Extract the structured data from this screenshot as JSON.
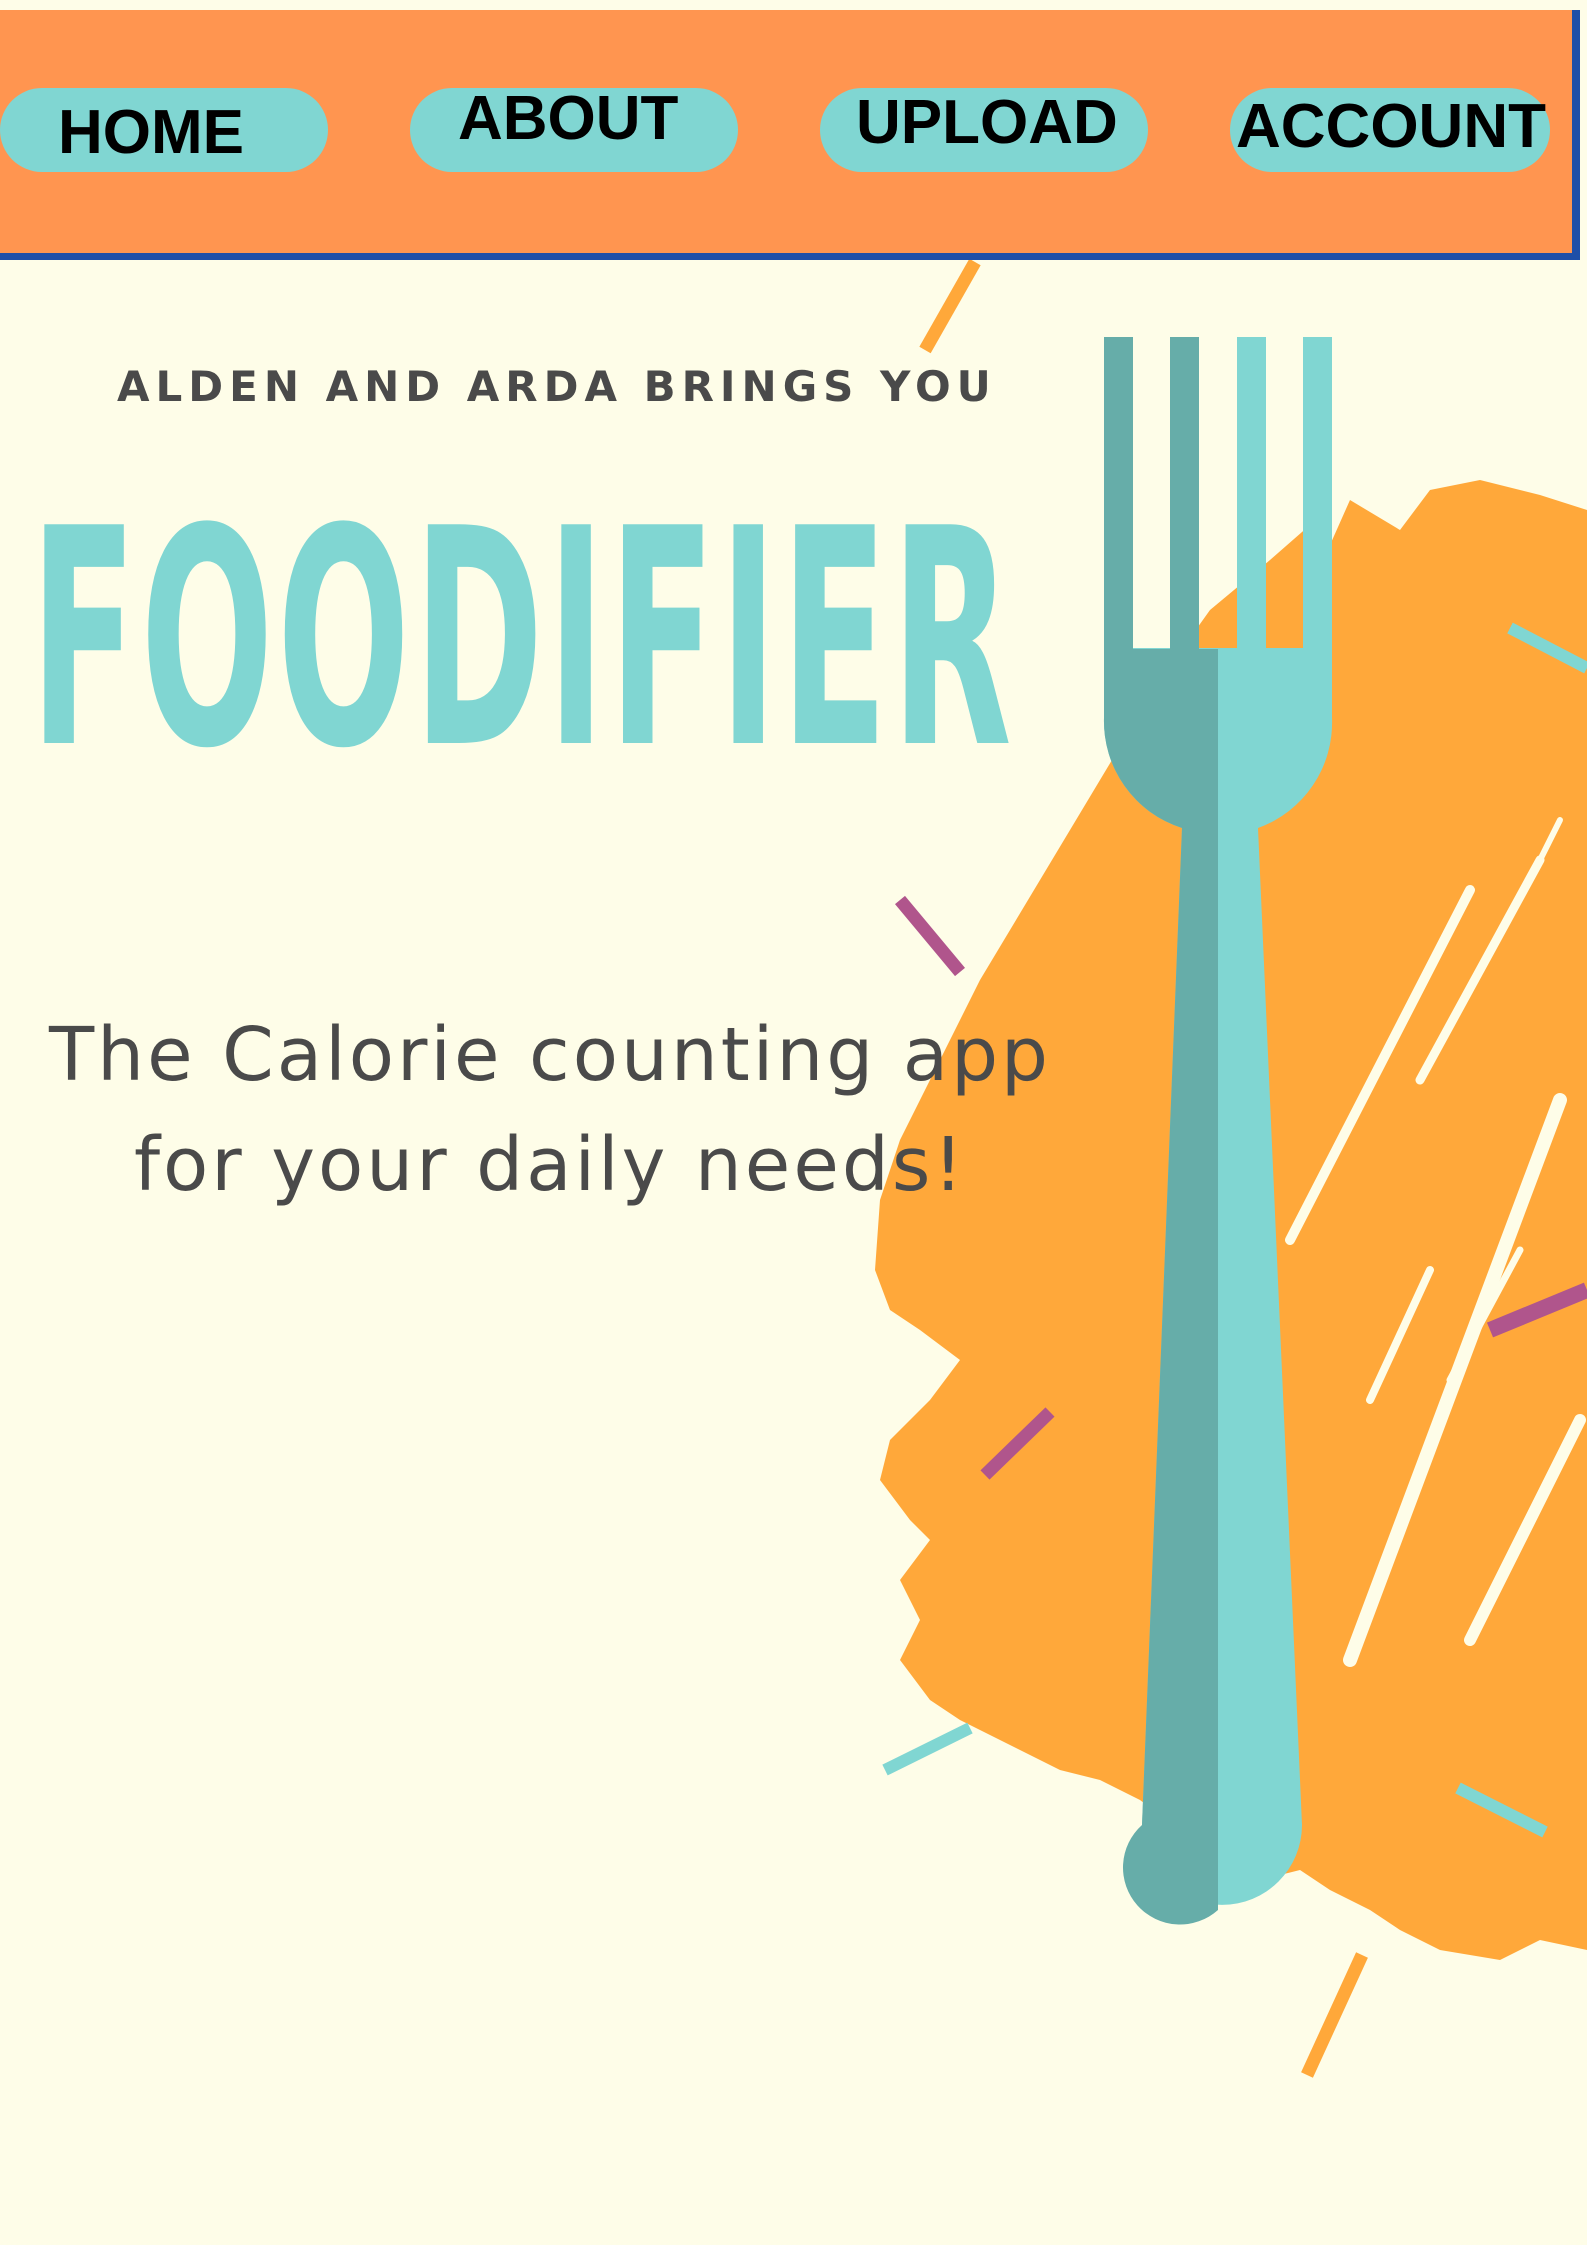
{
  "nav": {
    "items": [
      {
        "label": "HOME"
      },
      {
        "label": "ABOUT"
      },
      {
        "label": "UPLOAD"
      },
      {
        "label": "ACCOUNT"
      }
    ]
  },
  "hero": {
    "tagline": "ALDEN AND ARDA BRINGS YOU",
    "title": "FOODIFIER",
    "subtitle_line1": "The Calorie counting app",
    "subtitle_line2": "for your daily needs!"
  },
  "colors": {
    "background": "#fefde8",
    "navbar": "#ff9550",
    "navbar_border": "#1f4fa8",
    "button": "#80d6d2",
    "accent_teal": "#80d6d2",
    "fork_shadow": "#66ada9",
    "splash": "#ffa83a",
    "sprinkle_purple": "#b0558c",
    "text_dark": "#4a4a4a"
  },
  "icons": {
    "fork": "fork-icon"
  }
}
